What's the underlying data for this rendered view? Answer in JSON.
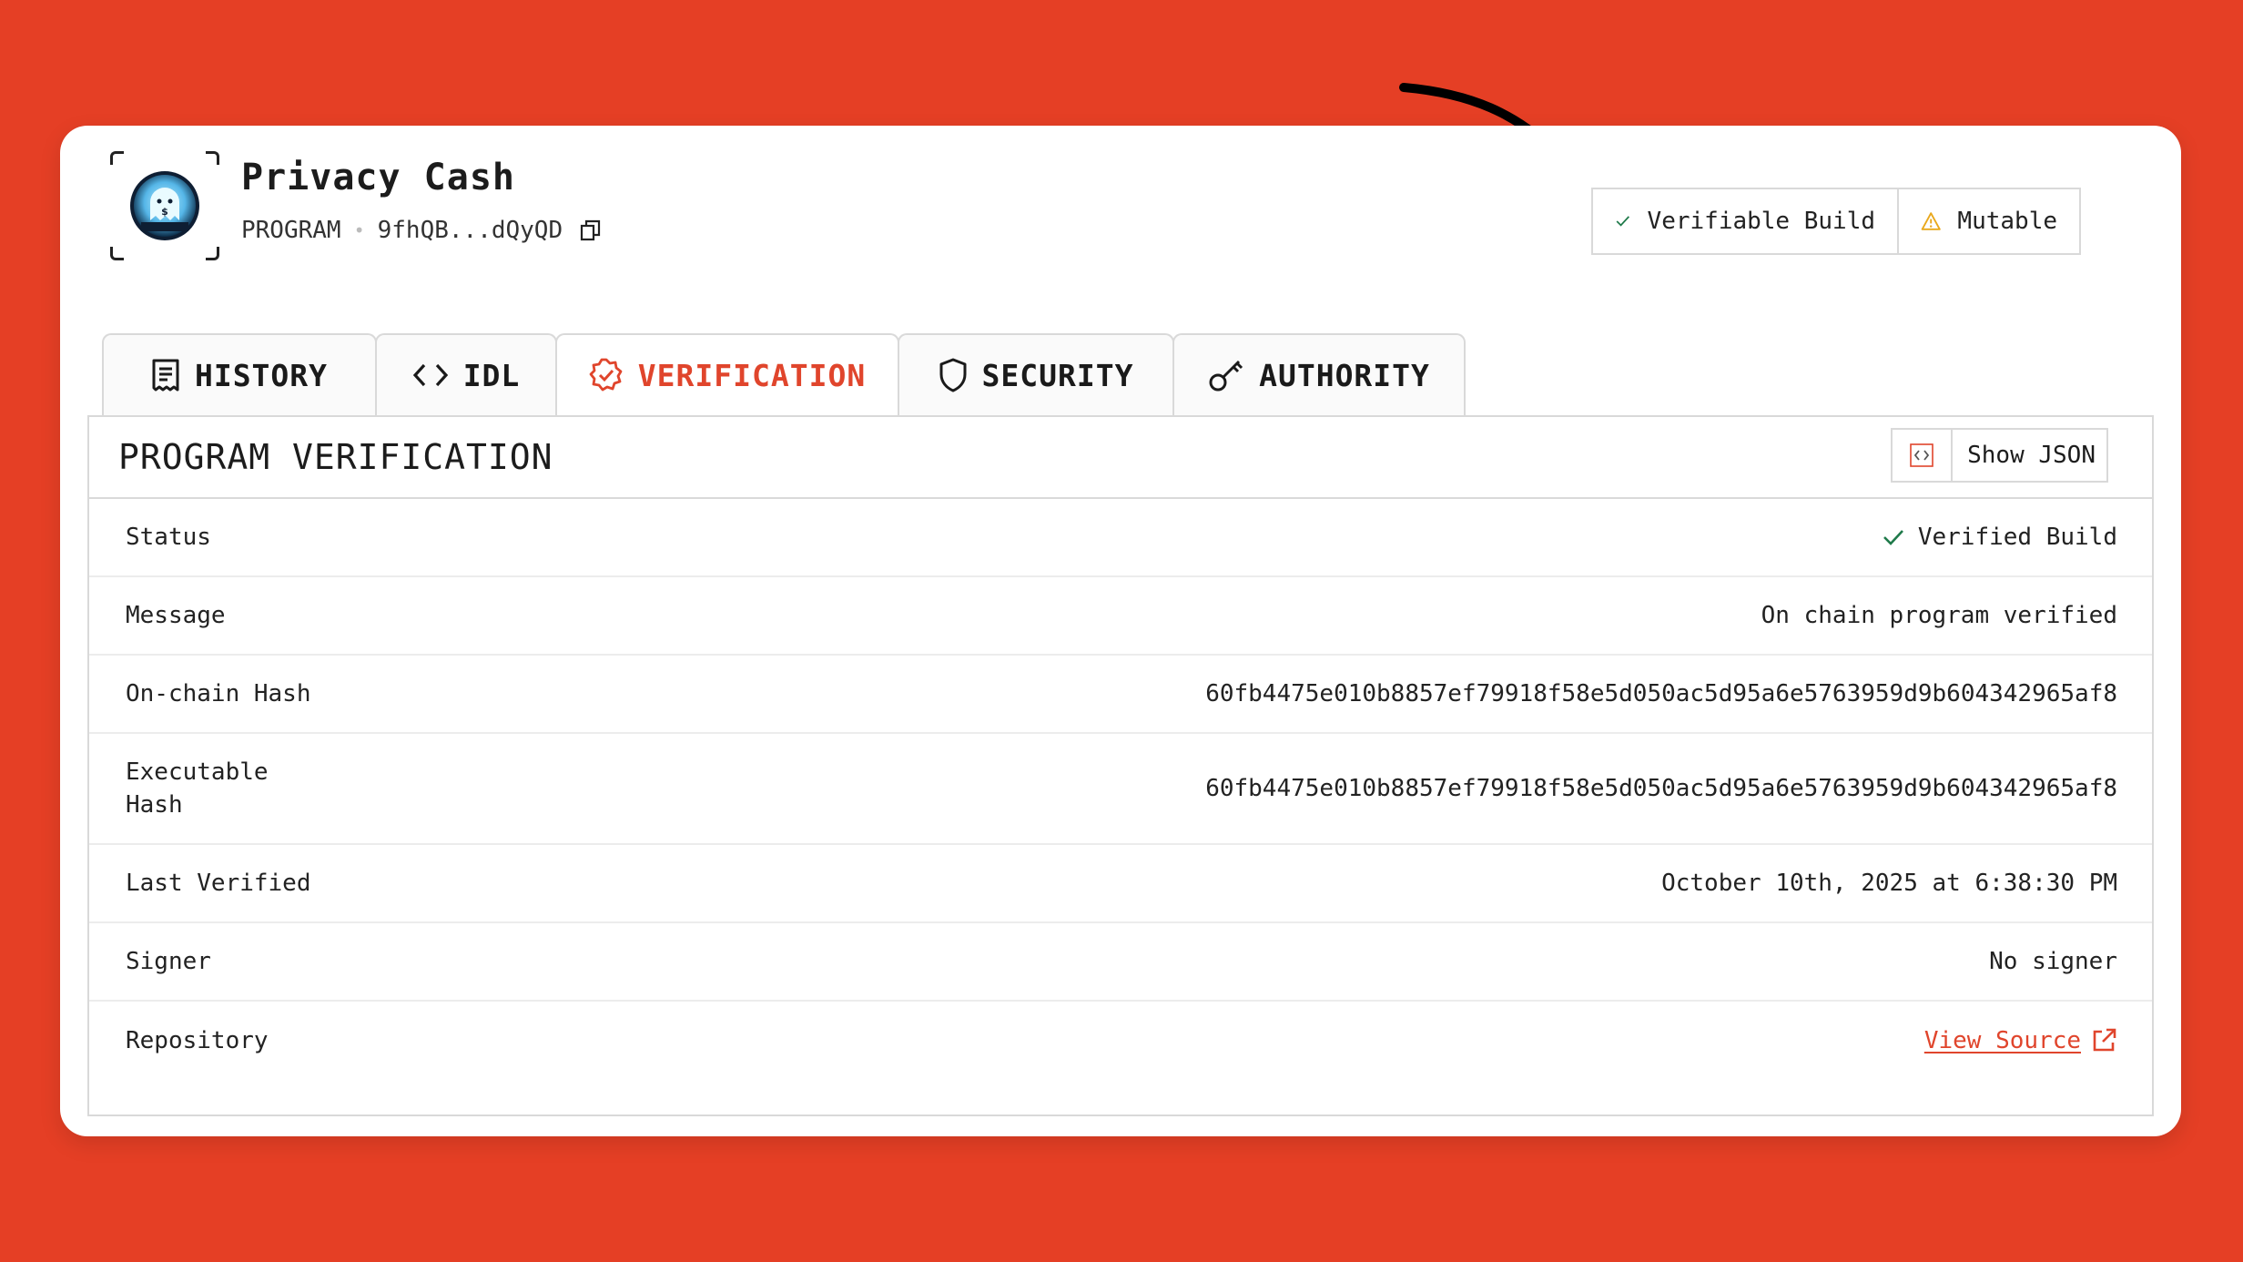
{
  "program": {
    "name": "Privacy Cash",
    "type_label": "PROGRAM",
    "address_short": "9fhQB...dQyQD",
    "logo_icon": "ghost-dollar-logo"
  },
  "badges": {
    "verifiable": "Verifiable Build",
    "mutable": "Mutable"
  },
  "tabs": [
    {
      "label": "HISTORY",
      "icon": "receipt-icon"
    },
    {
      "label": "IDL",
      "icon": "code-icon"
    },
    {
      "label": "VERIFICATION",
      "icon": "verified-badge-icon",
      "active": true
    },
    {
      "label": "SECURITY",
      "icon": "shield-icon"
    },
    {
      "label": "AUTHORITY",
      "icon": "key-icon"
    }
  ],
  "panel": {
    "title": "PROGRAM VERIFICATION",
    "show_json_label": "Show JSON"
  },
  "rows": [
    {
      "label": "Status",
      "value": "Verified Build"
    },
    {
      "label": "Message",
      "value": "On chain program verified"
    },
    {
      "label": "On-chain Hash",
      "value": "60fb4475e010b8857ef79918f58e5d050ac5d95a6e5763959d9b604342965af8"
    },
    {
      "label": "Executable Hash",
      "label_line1": "Executable",
      "label_line2": "Hash",
      "value": "60fb4475e010b8857ef79918f58e5d050ac5d95a6e5763959d9b604342965af8"
    },
    {
      "label": "Last Verified",
      "value": "October 10th, 2025 at 6:38:30 PM"
    },
    {
      "label": "Signer",
      "value": "No signer"
    },
    {
      "label": "Repository",
      "value": "View Source"
    }
  ],
  "colors": {
    "background": "#e53f25",
    "accent": "#e0452c",
    "success": "#1f7a4a",
    "warning": "#e9a81c"
  }
}
